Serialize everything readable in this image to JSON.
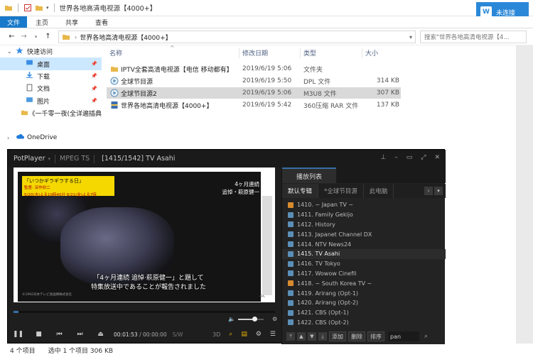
{
  "explorer": {
    "title": "世界各地高清电视源【4000+】",
    "signin_label": "未连接",
    "ribbon_tabs": [
      "文件",
      "主页",
      "共享",
      "查看"
    ],
    "address": "世界各地高清电视源【4000+】",
    "search_placeholder": "搜索\"世界各地高清电视源【4...",
    "columns": {
      "name": "名称",
      "date": "修改日期",
      "type": "类型",
      "size": "大小"
    },
    "files": [
      {
        "name": "IPTV全套高清电视源【电信 移动都有】",
        "date": "2019/6/19 5:06",
        "type": "文件夹",
        "size": "",
        "icon": "folder-icon"
      },
      {
        "name": "全球节目源",
        "date": "2019/6/19 5:50",
        "type": "DPL 文件",
        "size": "314 KB",
        "icon": "playlist-icon"
      },
      {
        "name": "全球节目源2",
        "date": "2019/6/19 5:06",
        "type": "M3U8 文件",
        "size": "307 KB",
        "icon": "playlist-icon"
      },
      {
        "name": "世界各地高清电视源【4000+】",
        "date": "2019/6/19 5:42",
        "type": "360压缩 RAR 文件",
        "size": "137 KB",
        "icon": "archive-icon"
      }
    ],
    "sidebar": [
      {
        "label": "快速访问",
        "icon": "star-icon",
        "level": 0,
        "chevron": "v"
      },
      {
        "label": "桌面",
        "icon": "desktop-icon",
        "level": 1,
        "pin": true
      },
      {
        "label": "下载",
        "icon": "download-icon",
        "level": 1,
        "pin": true
      },
      {
        "label": "文档",
        "icon": "document-icon",
        "level": 1,
        "pin": true
      },
      {
        "label": "图片",
        "icon": "picture-icon",
        "level": 1,
        "pin": true
      },
      {
        "label": "《一千零一夜(全详遍插典",
        "icon": "folder-icon",
        "level": 1,
        "pin": false
      },
      {
        "label": "",
        "icon": "",
        "level": 0
      },
      {
        "label": "OneDrive",
        "icon": "cloud-icon",
        "level": 0,
        "chevron": ">"
      }
    ],
    "status": {
      "items": "4 个项目",
      "selected": "选中 1 个项目 306 KB"
    }
  },
  "player": {
    "brand": "PotPlayer",
    "codec": "MPEG TS",
    "now_playing": "[1415/1542] TV Asahi",
    "video": {
      "tag_line1": "「いつかギラギラする日」",
      "tag_line2": "監督: 深作欣二",
      "tag_line3": "5/20(水)よる10時40分  6/21(金)よる7時",
      "corner_line1": "4ヶ月連続",
      "corner_line2": "追悼・萩原健一",
      "subtitle_line1": "「4ヶ月連続 追悼·萩原健一」と題して",
      "subtitle_line2": "特集放送中であることが報告されました",
      "copyright": "©1992日本テレビ放送網株式会社",
      "watermark": "4K"
    },
    "progress": 0.02,
    "volume": 0.65,
    "time_current": "00:01:53",
    "time_total": "00:00:00",
    "sw": "S/W",
    "label_3d": "3D",
    "playlist": {
      "header": "播放列表",
      "tabs": [
        "默认专辑",
        "*全球节目源",
        "此电脑"
      ],
      "items": [
        {
          "label": "1410. ~ Japan TV ~",
          "icon": "orange"
        },
        {
          "label": "1411. Family Gekijo",
          "icon": "blue"
        },
        {
          "label": "1412. History",
          "icon": "blue"
        },
        {
          "label": "1413. Japanet Channel DX",
          "icon": "blue"
        },
        {
          "label": "1414. NTV News24",
          "icon": "blue"
        },
        {
          "label": "1415. TV Asahi",
          "icon": "blue",
          "current": true
        },
        {
          "label": "1416. TV Tokyo",
          "icon": "blue"
        },
        {
          "label": "1417. Wowow Cinefil",
          "icon": "blue"
        },
        {
          "label": "1418. ~ South Korea TV ~",
          "icon": "orange"
        },
        {
          "label": "1419. Arirang (Opt-1)",
          "icon": "blue"
        },
        {
          "label": "1420. Arirang (Opt-2)",
          "icon": "blue"
        },
        {
          "label": "1421. CBS (Opt-1)",
          "icon": "blue"
        },
        {
          "label": "1422. CBS (Opt-2)",
          "icon": "blue"
        }
      ],
      "buttons": [
        "添加",
        "删除",
        "排序"
      ],
      "search_value": "pan"
    }
  }
}
